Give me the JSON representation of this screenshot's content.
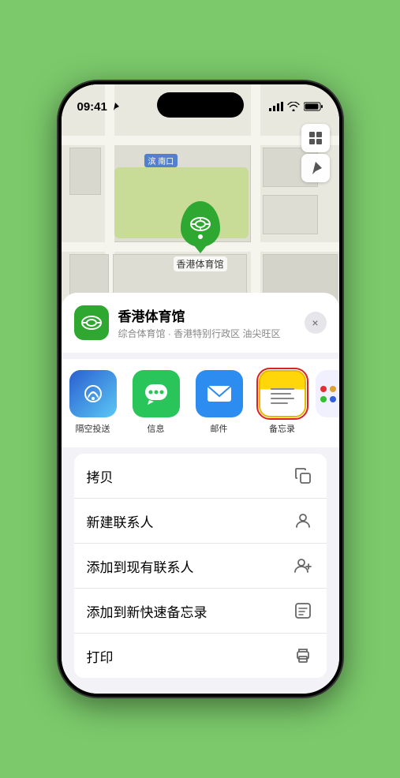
{
  "status_bar": {
    "time": "09:41",
    "location_arrow": true
  },
  "map": {
    "road_label": "南口",
    "road_prefix": "滨",
    "controls": [
      "map-type",
      "location"
    ]
  },
  "venue": {
    "name": "香港体育馆",
    "subtitle": "综合体育馆 · 香港特别行政区 油尖旺区",
    "marker_label": "香港体育馆"
  },
  "share_apps": [
    {
      "id": "airdrop",
      "label": "隔空投送",
      "type": "airdrop"
    },
    {
      "id": "messages",
      "label": "信息",
      "type": "messages"
    },
    {
      "id": "mail",
      "label": "邮件",
      "type": "mail"
    },
    {
      "id": "notes",
      "label": "备忘录",
      "type": "notes",
      "selected": true
    }
  ],
  "actions": [
    {
      "id": "copy",
      "label": "拷贝",
      "icon": "copy"
    },
    {
      "id": "new-contact",
      "label": "新建联系人",
      "icon": "person"
    },
    {
      "id": "add-contact",
      "label": "添加到现有联系人",
      "icon": "person-add"
    },
    {
      "id": "add-notes",
      "label": "添加到新快速备忘录",
      "icon": "notes"
    },
    {
      "id": "print",
      "label": "打印",
      "icon": "printer"
    }
  ],
  "close_button_label": "×"
}
